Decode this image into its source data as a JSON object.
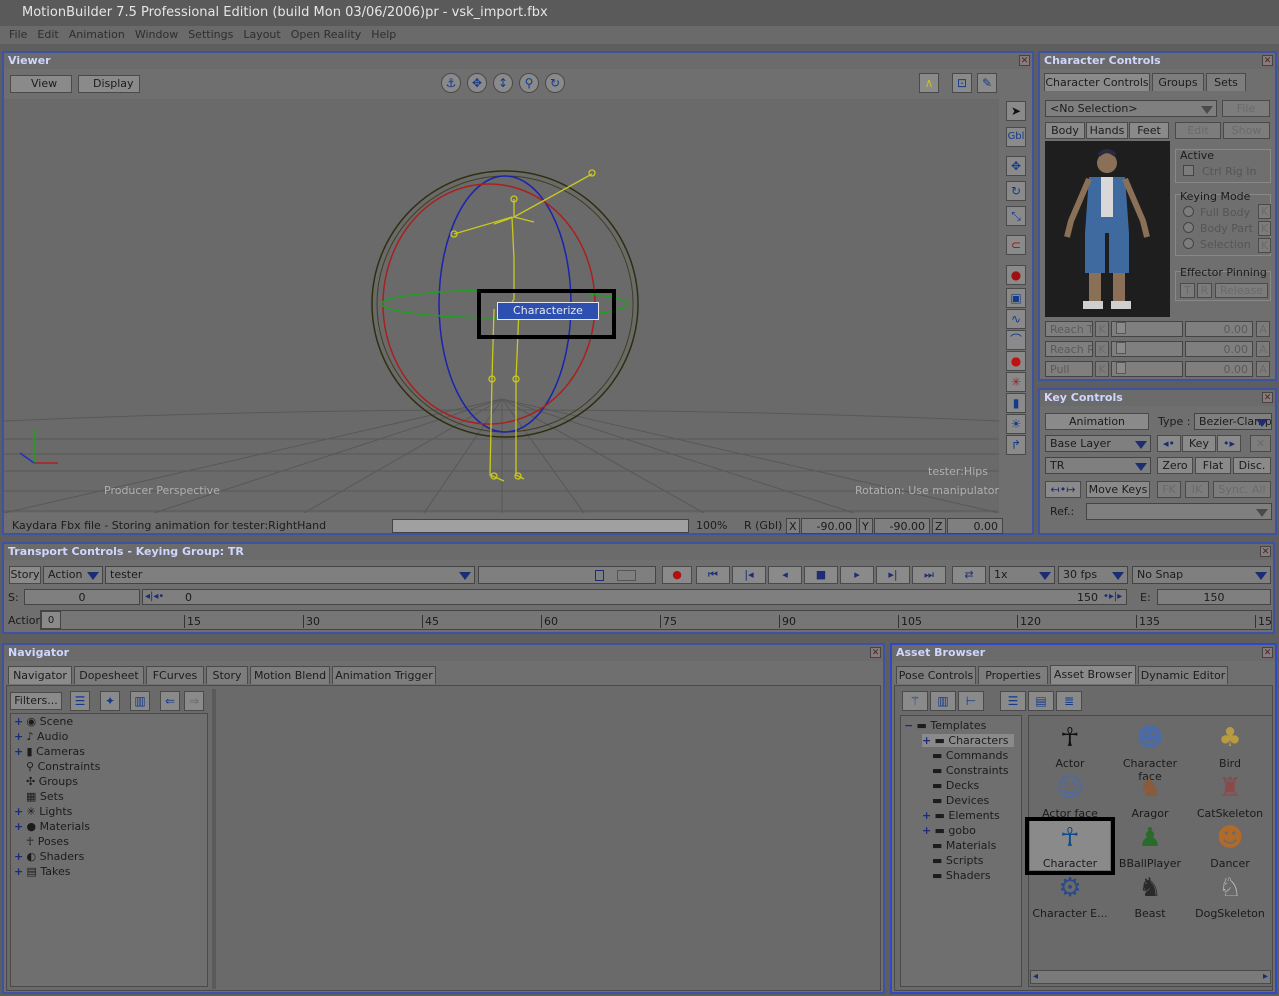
{
  "app": {
    "title": "MotionBuilder 7.5 Professional Edition (build Mon 03/06/2006)pr - vsk_import.fbx"
  },
  "menu": [
    "File",
    "Edit",
    "Animation",
    "Window",
    "Settings",
    "Layout",
    "Open Reality",
    "Help"
  ],
  "viewer": {
    "title": "Viewer",
    "view_label": "View",
    "display_label": "Display",
    "perspective_label": "Producer Perspective",
    "object_label": "tester:Hips",
    "rotation_label": "Rotation: Use manipulator",
    "status": "Kaydara Fbx file - Storing animation for tester:RightHand",
    "progress_label": "100%",
    "progress": 1.0,
    "rot_label": "R (Gbl)",
    "x_label": "X",
    "x_value": "-90.00",
    "y_label": "Y",
    "y_value": "-90.00",
    "z_label": "Z",
    "z_value": "0.00",
    "context_menu_item": "Characterize",
    "gbl_label": "Gbl"
  },
  "character_controls": {
    "title": "Character Controls",
    "tabs": [
      "Character Controls",
      "Groups",
      "Sets"
    ],
    "selection": "<No Selection>",
    "file_label": "File",
    "body_label": "Body",
    "hands_label": "Hands",
    "feet_label": "Feet",
    "edit_label": "Edit",
    "show_label": "Show",
    "active_label": "Active",
    "ctrl_rig_label": "Ctrl Rig In",
    "keying_mode_label": "Keying Mode",
    "full_body_label": "Full Body",
    "body_part_label": "Body Part",
    "selection_label": "Selection",
    "k_label": "K",
    "effector_label": "Effector Pinning",
    "t_label": "T",
    "r_label": "R",
    "release_label": "Release",
    "reach_t_label": "Reach T",
    "reach_r_label": "Reach R",
    "pull_label": "Pull",
    "reach_t_value": "0.00",
    "reach_r_value": "0.00",
    "pull_value": "0.00",
    "a_label": "A"
  },
  "key_controls": {
    "title": "Key Controls",
    "animation_label": "Animation",
    "type_label": "Type :",
    "type_value": "Bezier-Clamp",
    "layer_value": "Base Layer",
    "key_label": "Key",
    "tr_value": "TR",
    "zero_label": "Zero",
    "flat_label": "Flat",
    "disc_label": "Disc.",
    "move_keys_label": "Move Keys",
    "fk_label": "FK",
    "ik_label": "IK",
    "sync_label": "Sync. All",
    "ref_label": "Ref.:"
  },
  "transport": {
    "title": "Transport Controls  -  Keying Group: TR",
    "story_label": "Story",
    "action_label": "Action",
    "take_value": "tester",
    "speed_value": "1x",
    "fps_value": "30 fps",
    "snap_value": "No Snap",
    "s_label": "S:",
    "s_value": "0",
    "start_value": "0",
    "end_value": "150",
    "e_label": "E:",
    "e_value": "150",
    "action_row_label": "Action",
    "action_row_value": "0",
    "ticks": [
      "15",
      "30",
      "45",
      "60",
      "75",
      "90",
      "105",
      "120",
      "135",
      "15"
    ]
  },
  "navigator": {
    "title": "Navigator",
    "tabs": [
      "Navigator",
      "Dopesheet",
      "FCurves",
      "Story",
      "Motion Blend",
      "Animation Trigger"
    ],
    "filters_label": "Filters...",
    "tree": [
      {
        "label": "Scene",
        "plus": true
      },
      {
        "label": "Audio",
        "plus": true
      },
      {
        "label": "Cameras",
        "plus": true
      },
      {
        "label": "Constraints",
        "plus": false
      },
      {
        "label": "Groups",
        "plus": false
      },
      {
        "label": "Sets",
        "plus": false
      },
      {
        "label": "Lights",
        "plus": true
      },
      {
        "label": "Materials",
        "plus": true
      },
      {
        "label": "Poses",
        "plus": false
      },
      {
        "label": "Shaders",
        "plus": true
      },
      {
        "label": "Takes",
        "plus": true
      }
    ]
  },
  "asset_browser": {
    "title": "Asset Browser",
    "tabs": [
      "Pose Controls",
      "Properties",
      "Asset Browser",
      "Dynamic Editor"
    ],
    "tree_root": "Templates",
    "tree": [
      "Characters",
      "Commands",
      "Constraints",
      "Decks",
      "Devices",
      "Elements",
      "gobo",
      "Materials",
      "Scripts",
      "Shaders"
    ],
    "assets": [
      "Actor",
      "Character face",
      "Bird",
      "Actor face",
      "Aragor",
      "CatSkeleton",
      "Character",
      "BBallPlayer",
      "Dancer",
      "Character E...",
      "Beast",
      "DogSkeleton"
    ]
  }
}
